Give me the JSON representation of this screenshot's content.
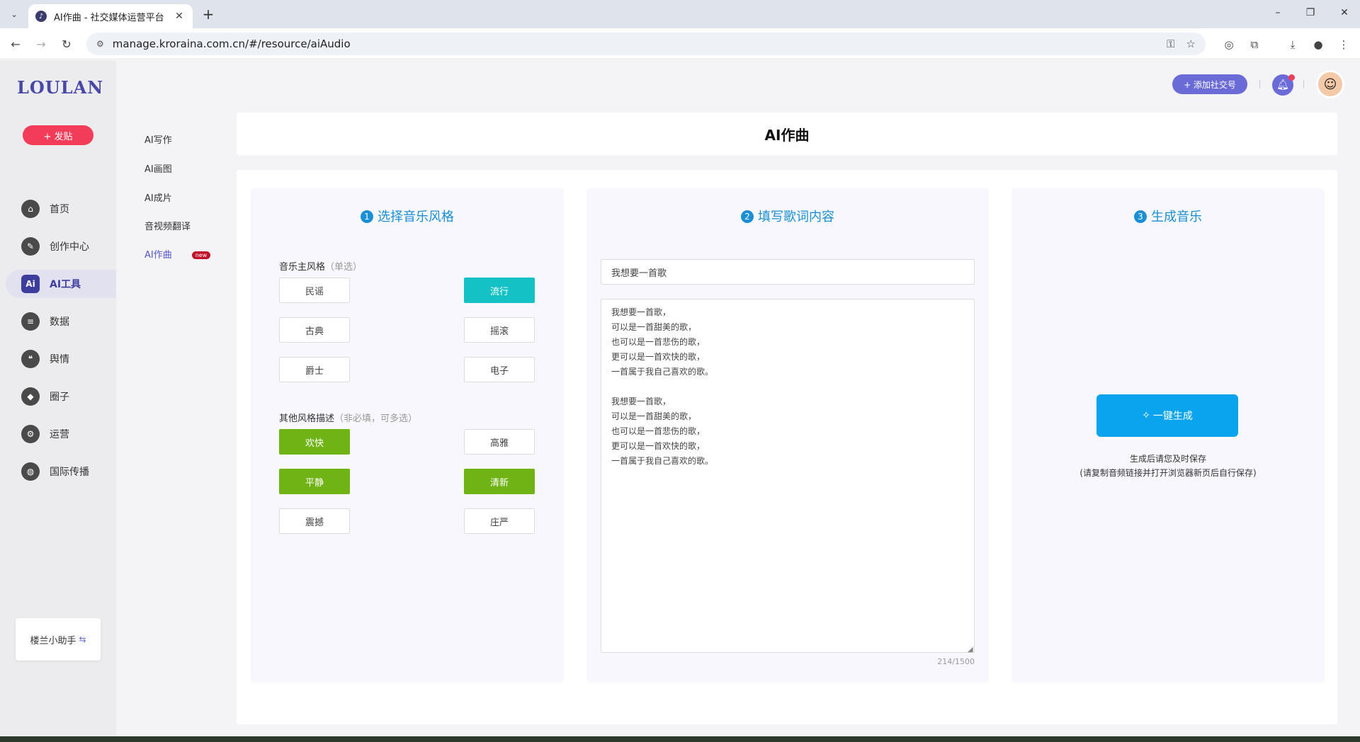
{
  "browser": {
    "tab_title": "AI作曲 - 社交媒体运营平台",
    "url": "manage.kroraina.com.cn/#/resource/aiAudio"
  },
  "app": {
    "logo": "LOULAN",
    "post_button": "+ 发贴",
    "rail": [
      {
        "label": "首页",
        "icon": "home-icon",
        "glyph": "⌂"
      },
      {
        "label": "创作中心",
        "icon": "palette-icon",
        "glyph": "✎"
      },
      {
        "label": "AI工具",
        "icon": "ai-icon",
        "glyph": "Ai"
      },
      {
        "label": "数据",
        "icon": "database-icon",
        "glyph": "≡"
      },
      {
        "label": "舆情",
        "icon": "quote-icon",
        "glyph": "❝"
      },
      {
        "label": "圈子",
        "icon": "compass-icon",
        "glyph": "◆"
      },
      {
        "label": "运营",
        "icon": "operation-icon",
        "glyph": "⚙"
      },
      {
        "label": "国际传播",
        "icon": "globe-icon",
        "glyph": "◍"
      }
    ],
    "helper_label": "楼兰小助手",
    "helper_icon": "⇆",
    "subnav": [
      "AI写作",
      "AI画图",
      "AI成片",
      "音视频翻译",
      "AI作曲"
    ],
    "new_badge": "new",
    "add_social_button": "+ 添加社交号",
    "avatar_glyph": "☺"
  },
  "page": {
    "title": "AI作曲",
    "step1": {
      "num": "1",
      "title": "选择音乐风格",
      "main_label": "音乐主风格",
      "main_hint": "（单选）",
      "main_options": [
        "民谣",
        "流行",
        "古典",
        "摇滚",
        "爵士",
        "电子"
      ],
      "main_selected": "流行",
      "other_label": "其他风格描述",
      "other_hint": "（非必填，可多选）",
      "other_options": [
        "欢快",
        "高雅",
        "平静",
        "清新",
        "震撼",
        "庄严"
      ],
      "other_selected": [
        "欢快",
        "平静",
        "清新"
      ]
    },
    "step2": {
      "num": "2",
      "title": "填写歌词内容",
      "song_title": "我想要一首歌",
      "lyrics": "我想要一首歌，\n可以是一首甜美的歌，\n也可以是一首悲伤的歌，\n更可以是一首欢快的歌，\n一首属于我自己喜欢的歌。\n\n我想要一首歌，\n可以是一首甜美的歌，\n也可以是一首悲伤的歌，\n更可以是一首欢快的歌，\n一首属于我自己喜欢的歌。",
      "counter": "214/1500"
    },
    "step3": {
      "num": "3",
      "title": "生成音乐",
      "generate_button": "一键生成",
      "note_line1": "生成后请您及时保存",
      "note_line2": "(请复制音频链接并打开浏览器新页后自行保存)"
    }
  },
  "colors": {
    "accent_blue": "#1a8fd6",
    "teal_selected": "#14c1c4",
    "green_selected": "#6fb314",
    "generate_blue": "#0aa4ee",
    "post_red": "#f23c5a",
    "brand_purple": "#4848a8"
  }
}
